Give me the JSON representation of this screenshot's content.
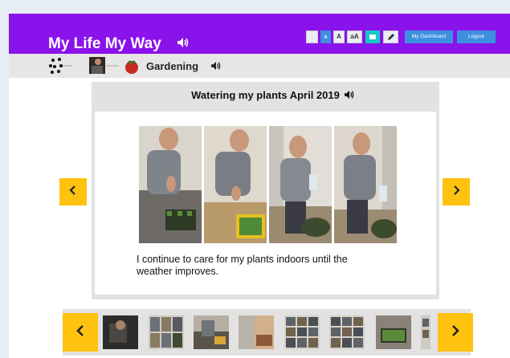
{
  "app": {
    "title": "My Life My Way",
    "accent_color": "#8a12ea",
    "nav_color": "#ffc20e"
  },
  "toolbar": {
    "text_small_label": "A",
    "text_medium_label": "A",
    "text_large_label": "aA",
    "dashboard_label": "My Dashboard",
    "logout_label": "Logout"
  },
  "breadcrumb": {
    "current_label": "Gardening"
  },
  "story": {
    "title": "Watering my plants April 2019",
    "caption": "I continue to care for my plants indoors until the weather improves.",
    "photo_count": 4
  },
  "navigation": {
    "prev_icon": "chevron-left-icon",
    "next_icon": "chevron-right-icon"
  },
  "thumbnails": {
    "count": 8
  }
}
